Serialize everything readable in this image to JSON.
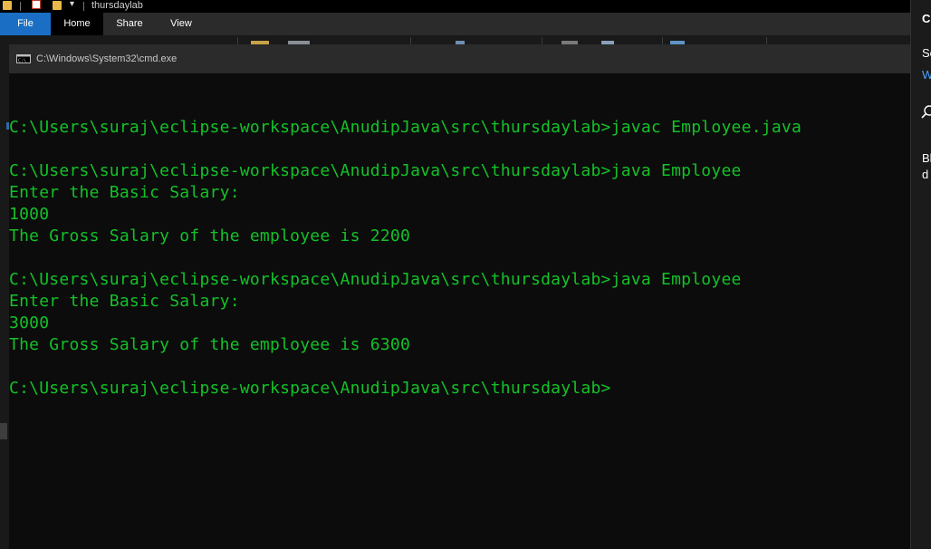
{
  "explorer": {
    "title": "thursdaylab",
    "tabs": {
      "file": "File",
      "home": "Home",
      "share": "Share",
      "view": "View"
    }
  },
  "cmd": {
    "title": "C:\\Windows\\System32\\cmd.exe",
    "lines": [
      "",
      "C:\\Users\\suraj\\eclipse-workspace\\AnudipJava\\src\\thursdaylab>javac Employee.java",
      "",
      "C:\\Users\\suraj\\eclipse-workspace\\AnudipJava\\src\\thursdaylab>java Employee",
      "Enter the Basic Salary:",
      "1000",
      "The Gross Salary of the employee is 2200",
      "",
      "C:\\Users\\suraj\\eclipse-workspace\\AnudipJava\\src\\thursdaylab>java Employee",
      "Enter the Basic Salary:",
      "3000",
      "The Gross Salary of the employee is 6300",
      "",
      "C:\\Users\\suraj\\eclipse-workspace\\AnudipJava\\src\\thursdaylab>"
    ],
    "text_color": "#13c228",
    "background": "#0c0c0c"
  },
  "side_panel": {
    "heading": "C",
    "line1": "Se",
    "link": "W",
    "line2": "Bl",
    "line3": "d",
    "icon": "search-icon"
  },
  "colors": {
    "file_tab": "#1a6fc4",
    "folder": "#e8b84a"
  }
}
